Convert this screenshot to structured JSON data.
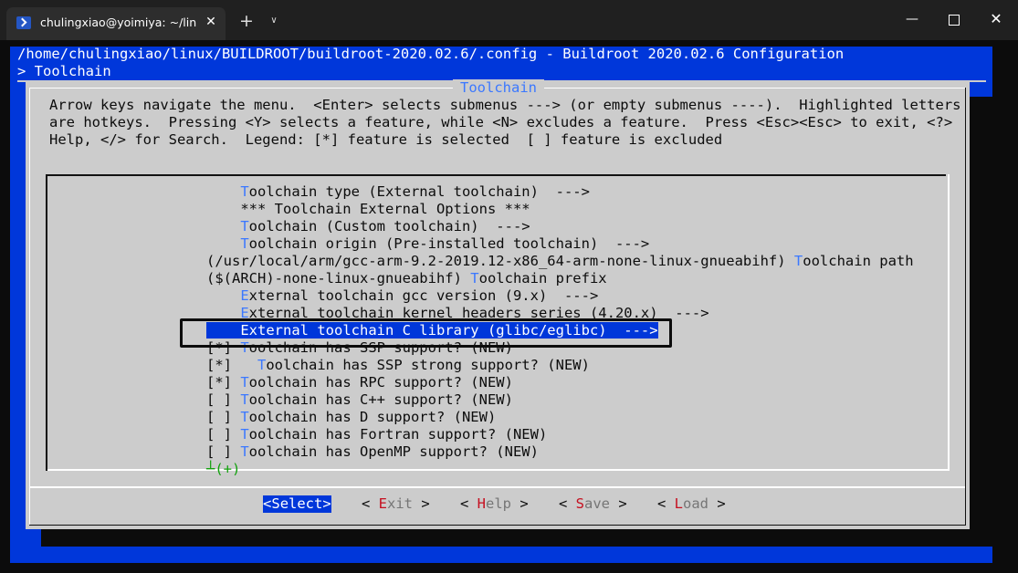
{
  "window": {
    "tab_title": "chulingxiao@yoimiya: ~/linux",
    "tab_close": "✕",
    "new_tab": "+",
    "tab_dropdown": "∨",
    "minimize": "—",
    "close": "✕"
  },
  "header": {
    "path": "/home/chulingxiao/linux/BUILDROOT/buildroot-2020.02.6/.config - Buildroot 2020.02.6 Configuration",
    "breadcrumb": "> Toolchain"
  },
  "dialog": {
    "title": "Toolchain",
    "help": [
      "Arrow keys navigate the menu.  <Enter> selects submenus ---> (or empty submenus ----).  Highlighted letters",
      "are hotkeys.  Pressing <Y> selects a feature, while <N> excludes a feature.  Press <Esc><Esc> to exit, <?> for",
      "Help, </> for Search.  Legend: [*] feature is selected  [ ] feature is excluded"
    ]
  },
  "menu": [
    {
      "prefix": "    ",
      "hotkey": "T",
      "text": "oolchain type (External toolchain)  --->"
    },
    {
      "prefix": "    ",
      "hotkey": "",
      "text": "*** Toolchain External Options ***"
    },
    {
      "prefix": "    ",
      "hotkey": "T",
      "text": "oolchain (Custom toolchain)  --->"
    },
    {
      "prefix": "    ",
      "hotkey": "T",
      "text": "oolchain origin (Pre-installed toolchain)  --->"
    },
    {
      "prefix": "(/usr/local/arm/gcc-arm-9.2-2019.12-x86_64-arm-none-linux-gnueabihf) ",
      "hotkey": "T",
      "text": "oolchain path"
    },
    {
      "prefix": "($(ARCH)-none-linux-gnueabihf) ",
      "hotkey": "T",
      "text": "oolchain prefix"
    },
    {
      "prefix": "    ",
      "hotkey": "E",
      "text": "xternal toolchain gcc version (9.x)  --->"
    },
    {
      "prefix": "    ",
      "hotkey": "E",
      "text": "xternal toolchain kernel headers series (4.20.x)  --->"
    },
    {
      "prefix": "    ",
      "hotkey": "E",
      "text": "xternal toolchain C library (glibc/eglibc)  --->",
      "selected": true
    },
    {
      "prefix": "[*] ",
      "hotkey": "T",
      "text": "oolchain has SSP support? (NEW)"
    },
    {
      "prefix": "[*]   ",
      "hotkey": "T",
      "text": "oolchain has SSP strong support? (NEW)"
    },
    {
      "prefix": "[*] ",
      "hotkey": "T",
      "text": "oolchain has RPC support? (NEW)"
    },
    {
      "prefix": "[ ] ",
      "hotkey": "T",
      "text": "oolchain has C++ support? (NEW)"
    },
    {
      "prefix": "[ ] ",
      "hotkey": "T",
      "text": "oolchain has D support? (NEW)"
    },
    {
      "prefix": "[ ] ",
      "hotkey": "T",
      "text": "oolchain has Fortran support? (NEW)"
    },
    {
      "prefix": "[ ] ",
      "hotkey": "T",
      "text": "oolchain has OpenMP support? (NEW)"
    }
  ],
  "more_indicator": "┴(+)",
  "buttons": [
    {
      "open": "<",
      "hotkey": "S",
      "rest": "elect",
      "close": ">",
      "active": true
    },
    {
      "open": "< ",
      "hotkey": "E",
      "rest": "xit",
      "close": " >"
    },
    {
      "open": "< ",
      "hotkey": "H",
      "rest": "elp",
      "close": " >"
    },
    {
      "open": "< ",
      "hotkey": "S",
      "rest": "ave",
      "close": " >"
    },
    {
      "open": "< ",
      "hotkey": "L",
      "rest": "oad",
      "close": " >"
    }
  ],
  "colors": {
    "backdrop": "#0037da",
    "dialog": "#cccccc",
    "hotkey_menu": "#3b78ff",
    "hotkey_button": "#c50f1f",
    "more_indicator": "#13a10e"
  }
}
